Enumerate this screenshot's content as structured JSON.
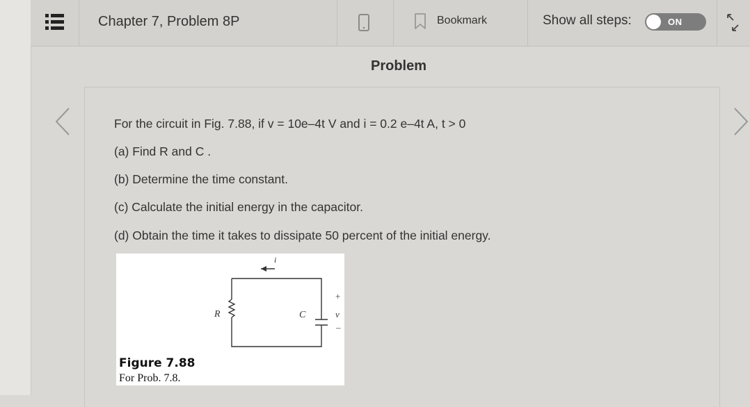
{
  "toolbar": {
    "menu_icon": "list-icon",
    "chapter_title": "Chapter 7, Problem 8P",
    "device_icon": "phone-icon",
    "bookmark_label": "Bookmark",
    "show_steps_label": "Show all steps:",
    "toggle_state": "ON",
    "expand_icon": "expand-icon"
  },
  "problem": {
    "heading": "Problem",
    "statement": "For the circuit in Fig. 7.88, if v = 10e–4t V and i = 0.2 e–4t A, t > 0",
    "parts": [
      "(a) Find R and C .",
      "(b) Determine the time constant.",
      "(c) Calculate the initial energy in the capacitor.",
      "(d) Obtain the time it takes to dissipate 50 percent of the initial energy."
    ]
  },
  "figure": {
    "title": "Figure 7.88",
    "subtitle": "For Prob. 7.8.",
    "labels": {
      "current": "i",
      "resistor": "R",
      "capacitor": "C",
      "voltage": "v",
      "plus": "+",
      "minus": "–"
    }
  },
  "nav": {
    "prev_icon": "chevron-left-icon",
    "next_icon": "chevron-right-icon"
  },
  "colors": {
    "toolbar_bg": "#d3d2ce",
    "page_bg": "#d9d8d4",
    "toggle_bg": "#7d7d7d"
  }
}
